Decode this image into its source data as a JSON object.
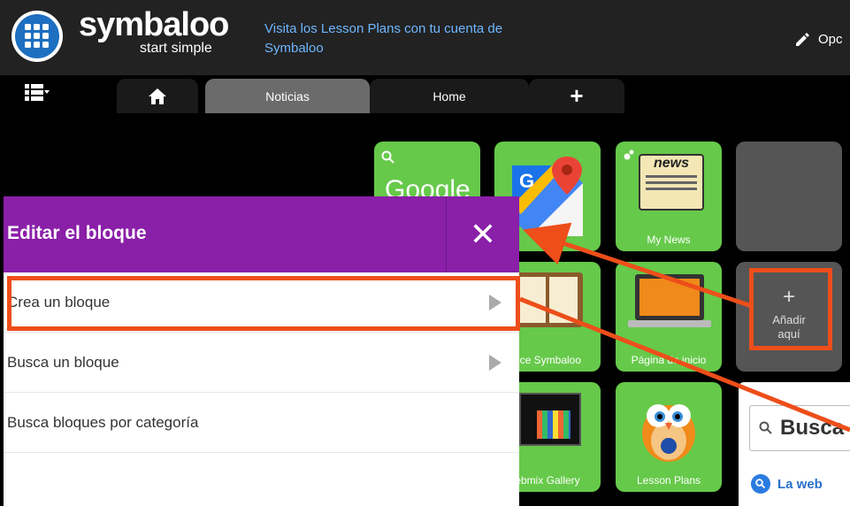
{
  "header": {
    "brand": "symbaloo",
    "brand_sub": "start simple",
    "promo": "Visita los Lesson Plans con tu cuenta de Symbaloo",
    "options_label": "Opc"
  },
  "tabs": {
    "noticias": "Noticias",
    "home": "Home",
    "add": "+"
  },
  "tiles": {
    "google": "Google",
    "my_news": "My News",
    "news_word": "news",
    "symbaloo": "oce Symbaloo",
    "pagina": "Página de inicio",
    "gallery": "ebmix Gallery",
    "lesson": "Lesson Plans",
    "add_plus": "+",
    "add_label": "Añadir aquí"
  },
  "panel": {
    "title": "Editar el bloque",
    "close": "✕",
    "items": [
      {
        "label": "Crea un bloque"
      },
      {
        "label": "Busca un bloque"
      },
      {
        "label": "Busca bloques por categoría"
      }
    ]
  },
  "search": {
    "placeholder": "Busca",
    "web": "La web"
  },
  "colors": {
    "accent": "#8a1fa8",
    "tile_green": "#66c94a",
    "highlight": "#ee4e1a",
    "link_blue": "#6eb7ff"
  }
}
